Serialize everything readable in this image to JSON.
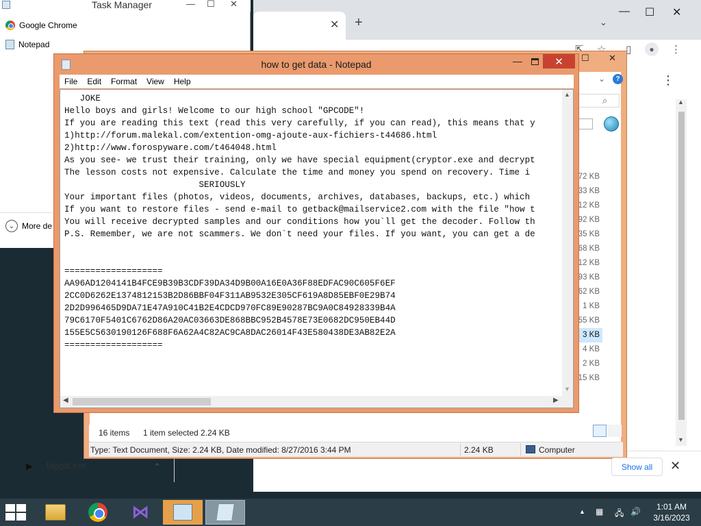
{
  "task_manager": {
    "title": "Task Manager",
    "apps": [
      "Google Chrome",
      "Notepad"
    ],
    "more_details": "More de"
  },
  "chrome": {
    "downloads": {
      "filename": "faggot.exe",
      "show_all": "Show all"
    }
  },
  "explorer": {
    "sizes": [
      "72 KB",
      "33 KB",
      "12 KB",
      "92 KB",
      "35 KB",
      "68 KB",
      "12 KB",
      "93 KB",
      "62 KB",
      "1 KB",
      "55 KB",
      "3 KB",
      "4 KB",
      "2 KB",
      "15 KB"
    ],
    "selected_index": 11,
    "status": {
      "items": "16 items",
      "selected": "1 item selected  2.24 KB"
    },
    "details": {
      "info": "Type: Text Document, Size: 2.24 KB, Date modified: 8/27/2016 3:44 PM",
      "size": "2.24 KB",
      "location": "Computer"
    }
  },
  "notepad": {
    "title": "how to get data - Notepad",
    "menu": [
      "File",
      "Edit",
      "Format",
      "View",
      "Help"
    ],
    "lines": [
      "   JOKE",
      "Hello boys and girls! Welcome to our high school \"GPCODE\"!",
      "If you are reading this text (read this very carefully, if you can read), this means that y",
      "1)http://forum.malekal.com/extention-omg-ajoute-aux-fichiers-t44686.html",
      "2)http://www.forospyware.com/t464048.html",
      "As you see- we trust their training, only we have special equipment(cryptor.exe and decrypt",
      "The lesson costs not expensive. Calculate the time and money you spend on recovery. Time i",
      "                          SERIOUSLY",
      "Your important files (photos, videos, documents, archives, databases, backups, etc.) which",
      "If you want to restore files - send e-mail to getback@mailservice2.com with the file \"how t",
      "You will receive decrypted samples and our conditions how you`ll get the decoder. Follow th",
      "P.S. Remember, we are not scammers. We don`t need your files. If you want, you can get a de",
      "",
      "",
      "===================",
      "AA96AD1204141B4FCE9B39B3CDF39DA34D9B00A16E0A36F88EDFAC90C605F6EF",
      "2CC0D6262E1374812153B2D86BBF04F311AB9532E305CF619A8D85EBF0E29B74",
      "2D2D996465D9DA71E47A910C41B2E4CDCD970FC89E90287BC9A0C84928339B4A",
      "79C6170F5401C6762D86A20AC03663DE868BBC952B4578E73E0682DC950EB44D",
      "155E5C5630190126F688F6A62A4C82AC9CA8DAC26014F43E580438DE3AB82E2A",
      "==================="
    ]
  },
  "taskbar": {
    "time": "1:01 AM",
    "date": "3/16/2023"
  }
}
